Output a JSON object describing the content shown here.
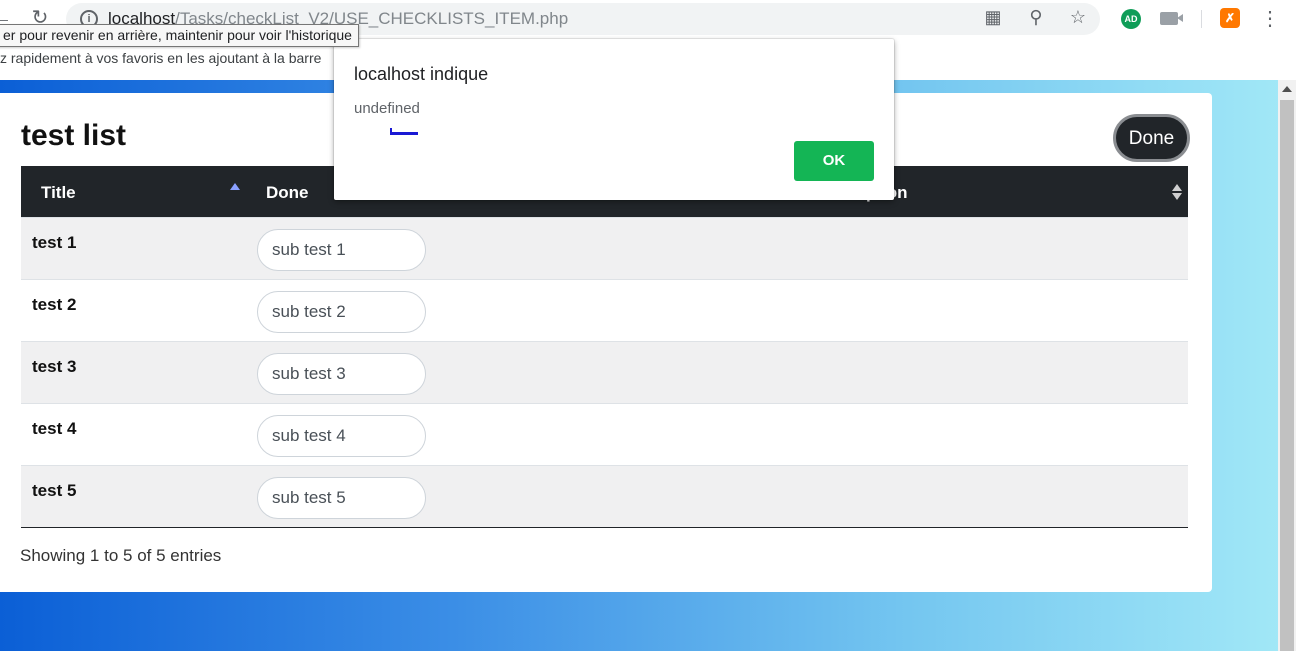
{
  "browser": {
    "url_host": "localhost",
    "url_path": "/Tasks/checkList_V2/USE_CHECKLISTS_ITEM.php",
    "tooltip": "er pour revenir en arrière, maintenir pour voir l'historique",
    "bookmark_hint": "z rapidement à vos favoris en les ajoutant à la barre",
    "ext_ad_label": "AD"
  },
  "page": {
    "title": "test list",
    "done_button": "Done",
    "footer_info": "Showing 1 to 5 of 5 entries"
  },
  "table": {
    "columns": [
      "Title",
      "Done",
      "Description"
    ],
    "visible_column_fragment": "ption",
    "rows": [
      {
        "title": "test 1",
        "sub": "sub test 1"
      },
      {
        "title": "test 2",
        "sub": "sub test 2"
      },
      {
        "title": "test 3",
        "sub": "sub test 3"
      },
      {
        "title": "test 4",
        "sub": "sub test 4"
      },
      {
        "title": "test 5",
        "sub": "sub test 5"
      }
    ]
  },
  "dialog": {
    "title": "localhost indique",
    "message": "undefined",
    "ok_label": "OK"
  },
  "colors": {
    "header_bg": "#212529",
    "ok_button": "#14b555",
    "gradient_start": "#0b5fd6",
    "gradient_end": "#a3e9f7"
  },
  "icons": {
    "back": "back-arrow-icon",
    "reload": "reload-icon",
    "info": "info-icon",
    "translate": "translate-icon",
    "zoom": "zoom-out-icon",
    "star": "star-icon",
    "camera": "camera-icon",
    "avast": "avast-icon",
    "menu": "kebab-menu-icon"
  }
}
